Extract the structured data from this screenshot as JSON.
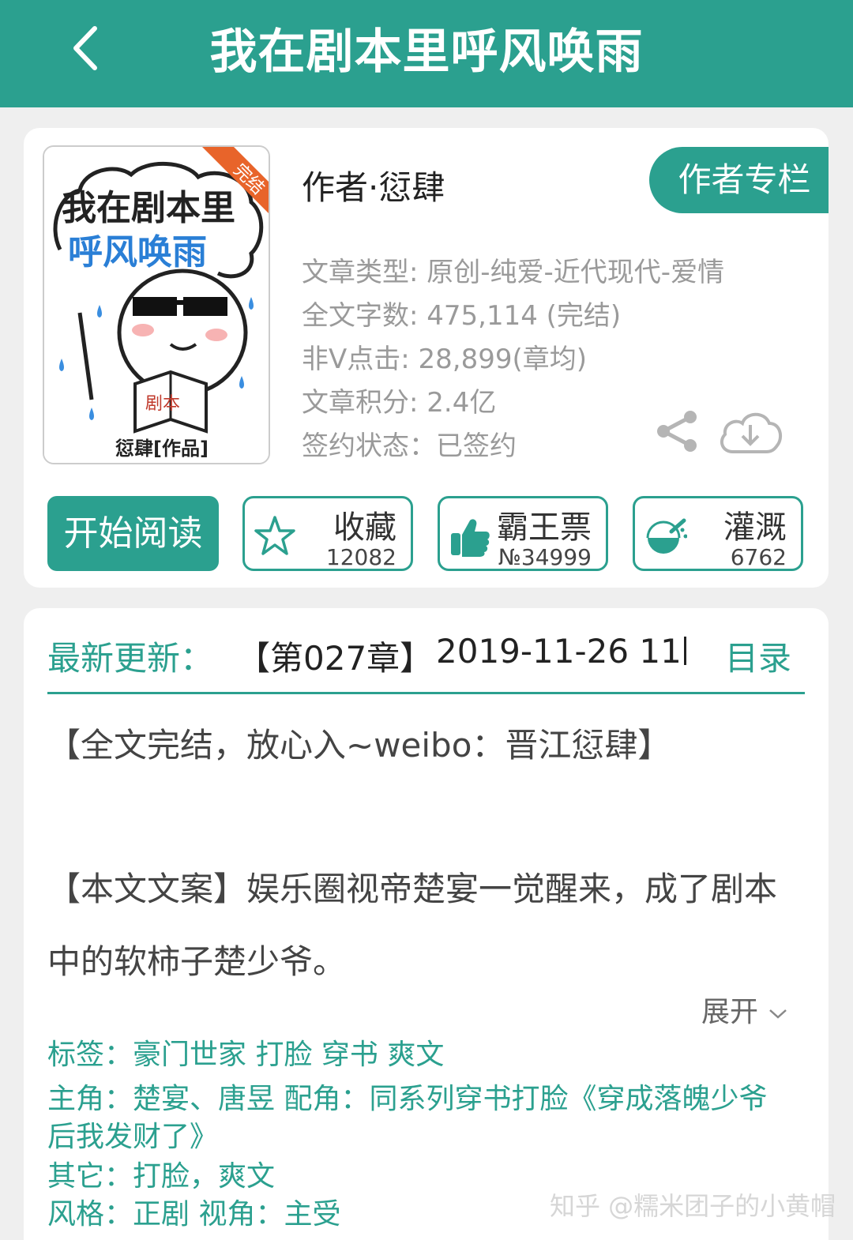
{
  "header": {
    "title": "我在剧本里呼风唤雨",
    "back_icon": "chevron-left-icon"
  },
  "book": {
    "cover": {
      "title_line1": "我在剧本里",
      "title_line2": "呼风唤雨",
      "ribbon": "完结",
      "book_text": "剧本",
      "credit": "愆肆[作品]"
    },
    "author": "作者·愆肆",
    "author_column_label": "作者专栏",
    "meta": {
      "type": "文章类型: 原创-纯爱-近代现代-爱情",
      "words": "全文字数: 475,114 (完结)",
      "clicks": "非Ⅴ点击: 28,899(章均)",
      "score": "文章积分: 2.4亿",
      "sign": "签约状态：已签约"
    },
    "read_button": "开始阅读",
    "actions": [
      {
        "label": "收藏",
        "count": "12082",
        "icon": "star-icon"
      },
      {
        "label": "霸王票",
        "count": "№34999",
        "icon": "thumbs-up-icon"
      },
      {
        "label": "灌溉",
        "count": "6762",
        "icon": "watering-icon"
      }
    ]
  },
  "update": {
    "label": "最新更新：",
    "chapter": "【第027章】",
    "date": "2019-11-26 11:",
    "toc": "目录"
  },
  "summary": {
    "line1": "【全文完结，放心入~weibo：晋江愆肆】",
    "line2": "【本文文案】娱乐圈视帝楚宴一觉醒来，成了剧本中的软柿子楚少爷。",
    "expand": "展开"
  },
  "tags": {
    "tags_line": "标签：豪门世家  打脸  穿书  爽文",
    "roles_line1": "主角：楚宴、唐昱        配角：同系列穿书打脸《穿成落魄少爷",
    "roles_line2": "后我发财了》",
    "other_line": "其它：打脸，爽文",
    "style_line": "风格：正剧        视角：主受"
  },
  "watermark": "知乎 @糯米团子的小黄帽",
  "colors": {
    "accent": "#2ba08f",
    "meta_gray": "#9a9a9a"
  }
}
